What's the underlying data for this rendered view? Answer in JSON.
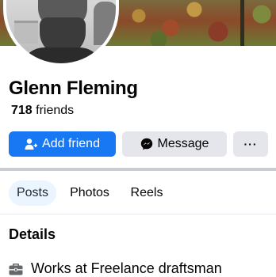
{
  "profile": {
    "name": "Glenn Fleming",
    "friends_count": "718",
    "friends_label": "friends"
  },
  "actions": {
    "add_friend_label": "Add friend",
    "message_label": "Message",
    "more_label": "···"
  },
  "tabs": [
    {
      "label": "Posts",
      "active": true
    },
    {
      "label": "Photos",
      "active": false
    },
    {
      "label": "Reels",
      "active": false
    }
  ],
  "details": {
    "heading": "Details",
    "items": [
      {
        "icon": "briefcase-icon",
        "text": "Works at Freelance draftsman"
      }
    ]
  },
  "colors": {
    "primary": "#1877f2",
    "secondary_button": "#e4e6eb",
    "active_tab_bg": "#ebf5ff"
  }
}
